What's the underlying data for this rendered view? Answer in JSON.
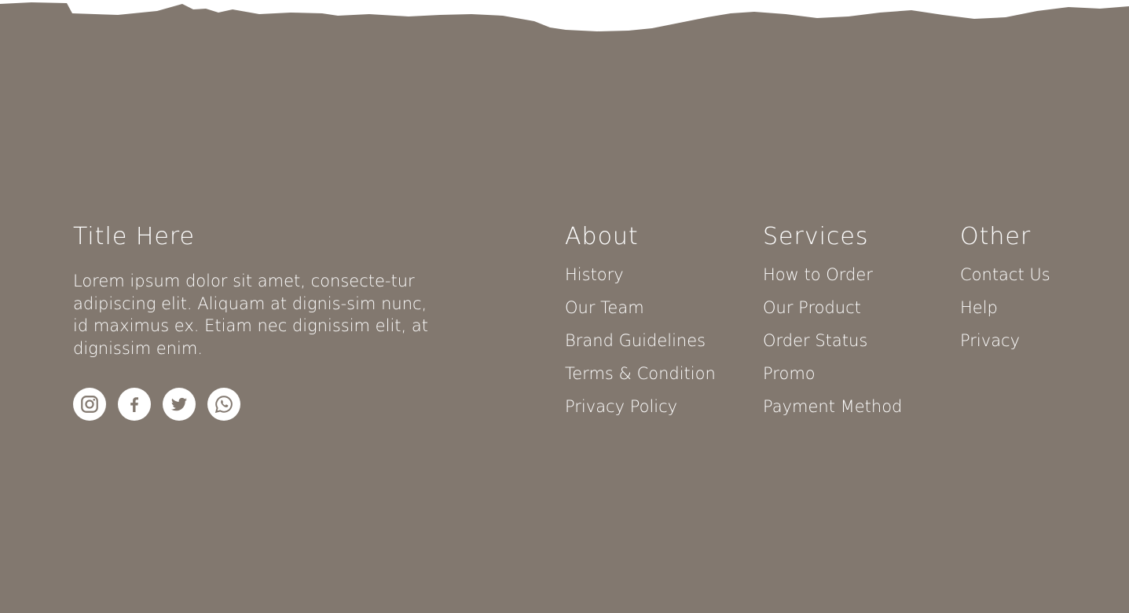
{
  "colors": {
    "footer_background": "#82786f",
    "text": "#ffffff",
    "page_background": "#ffffff"
  },
  "brand": {
    "title": "Title Here",
    "description": "Lorem ipsum dolor sit amet, consecte-tur adipiscing elit. Aliquam at dignis-sim nunc, id maximus ex. Etiam nec dignissim elit, at dignissim enim."
  },
  "socials": [
    {
      "icon": "instagram-icon"
    },
    {
      "icon": "facebook-icon"
    },
    {
      "icon": "twitter-icon"
    },
    {
      "icon": "whatsapp-icon"
    }
  ],
  "columns": {
    "about": {
      "title": "About",
      "links": [
        "History",
        "Our Team",
        "Brand Guidelines",
        "Terms & Condition",
        "Privacy Policy"
      ]
    },
    "services": {
      "title": "Services",
      "links": [
        "How to Order",
        "Our Product",
        "Order Status",
        "Promo",
        "Payment Method"
      ]
    },
    "other": {
      "title": "Other",
      "links": [
        "Contact Us",
        "Help",
        "Privacy"
      ]
    }
  }
}
